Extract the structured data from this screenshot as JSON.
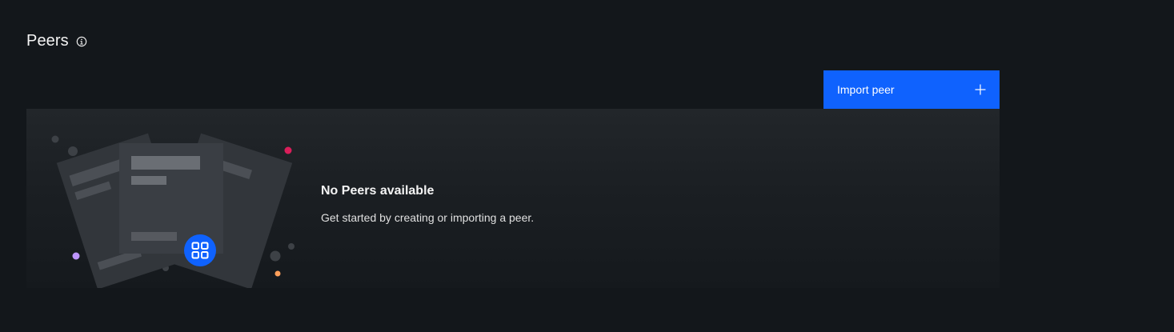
{
  "section": {
    "title": "Peers"
  },
  "actions": {
    "import_label": "Import peer"
  },
  "empty_state": {
    "title": "No Peers available",
    "description": "Get started by creating or importing a peer."
  },
  "colors": {
    "primary": "#0f62fe",
    "background": "#13171b",
    "dot_pink": "#da1e5a",
    "dot_purple": "#be95ff",
    "dot_orange": "#ff9f5a"
  },
  "icons": {
    "info": "info-icon",
    "add": "plus-icon",
    "peer_badge": "grid-icon"
  }
}
